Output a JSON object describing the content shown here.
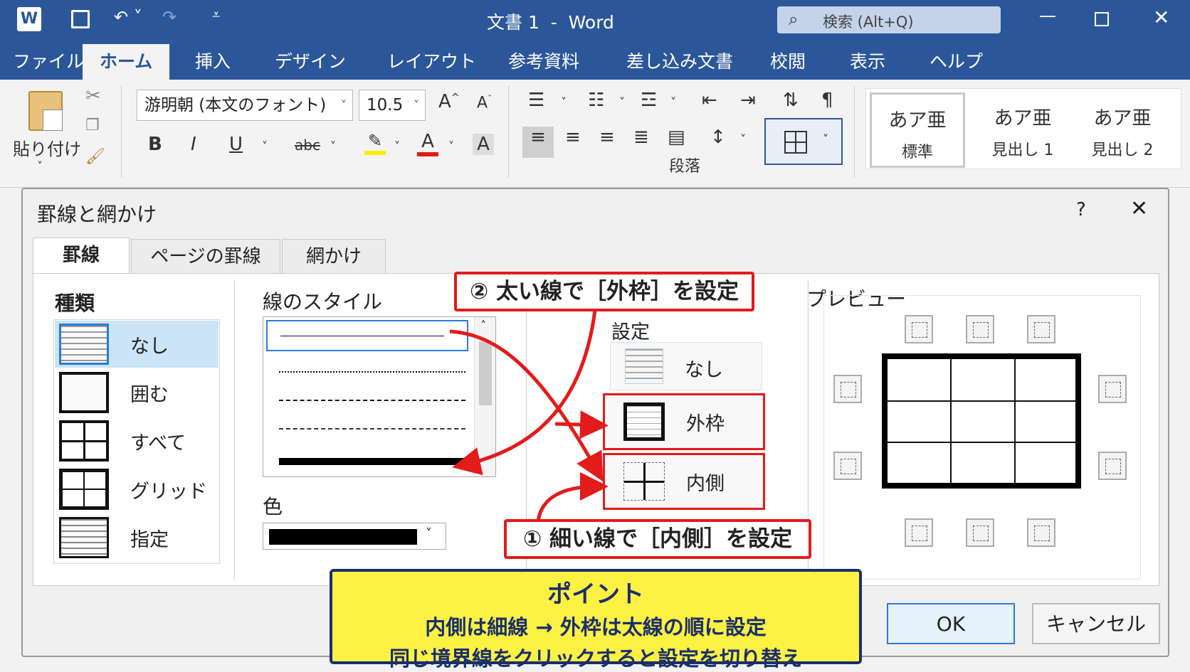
{
  "titlebar": {
    "doc_title": "文書 1  -  Word",
    "search_placeholder": "検索 (Alt+Q)"
  },
  "ribbon_tabs": [
    "ファイル",
    "ホーム",
    "挿入",
    "デザイン",
    "レイアウト",
    "参考資料",
    "差し込み文書",
    "校閲",
    "表示",
    "ヘルプ"
  ],
  "ribbon": {
    "paste_label": "貼り付け",
    "font_name": "游明朝 (本文のフォント)",
    "font_size": "10.5",
    "paragraph_group": "段落",
    "styles": [
      {
        "sample": "あア亜",
        "name": "標準"
      },
      {
        "sample": "あア亜",
        "name": "見出し 1"
      },
      {
        "sample": "あア亜",
        "name": "見出し 2"
      }
    ]
  },
  "dialog": {
    "title": "罫線と網かけ",
    "help": "?",
    "tabs": [
      "罫線",
      "ページの罫線",
      "網かけ"
    ],
    "kind_label": "種類",
    "kinds": [
      "なし",
      "囲む",
      "すべて",
      "グリッド",
      "指定"
    ],
    "line_style_label": "線のスタイル",
    "color_label": "色",
    "settings_label": "設定",
    "settings": [
      "なし",
      "外枠",
      "内側"
    ],
    "preview_label": "プレビュー",
    "ok": "OK",
    "cancel": "キャンセル"
  },
  "annotations": {
    "step2": "② 太い線で［外枠］を設定",
    "step1": "① 細い線で［内側］を設定",
    "point_title": "ポイント",
    "point_line1": "内側は細線 → 外枠は太線の順に設定",
    "point_line2": "同じ境界線をクリックすると設定を切り替え"
  },
  "colors": {
    "word_blue": "#2b579a",
    "callout_red": "#e31b1b",
    "point_yellow": "#fdf144",
    "point_border": "#1a2f6b"
  }
}
